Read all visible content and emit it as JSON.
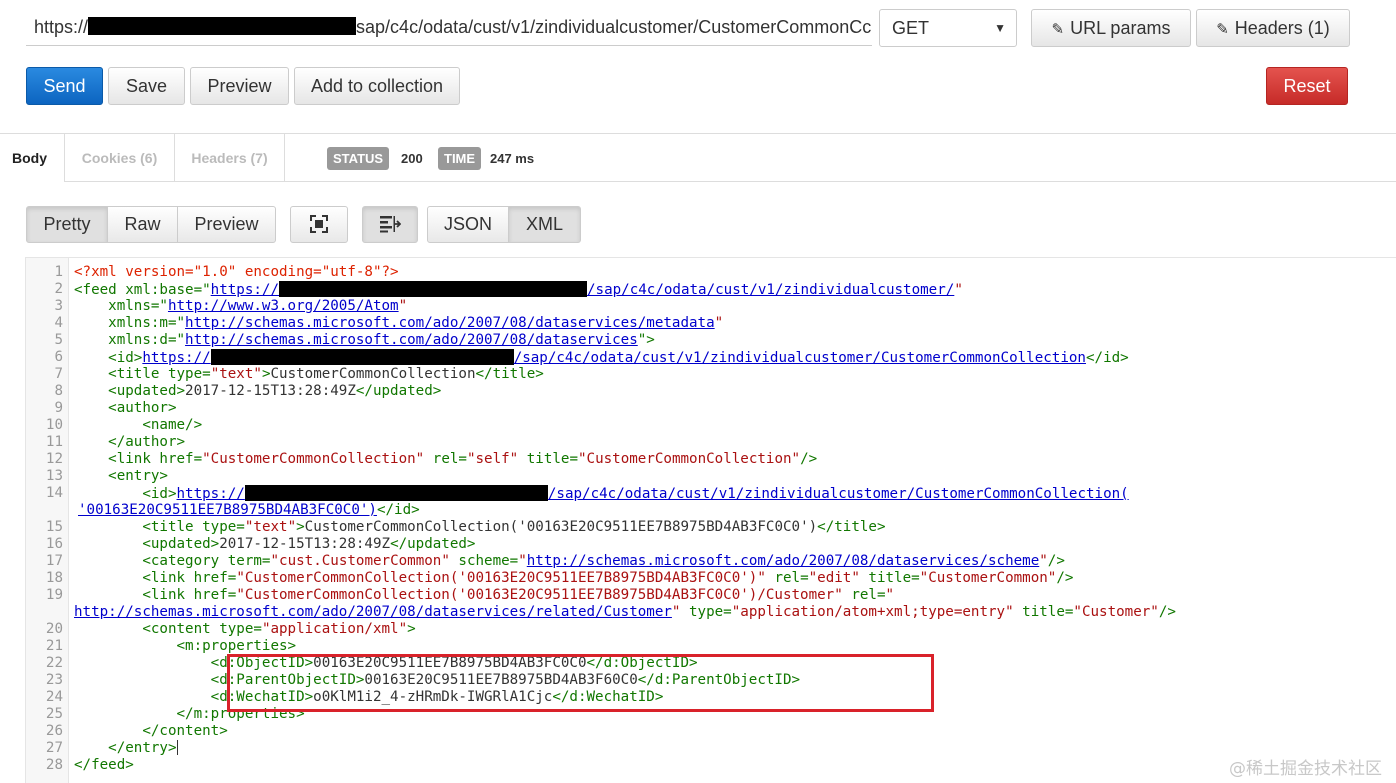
{
  "request": {
    "url_prefix": "https://",
    "url_suffix": "sap/c4c/odata/cust/v1/zindividualcustomer/CustomerCommonCc",
    "method": "GET",
    "url_params_label": "URL params",
    "headers_label": "Headers (1)"
  },
  "actions": {
    "send": "Send",
    "save": "Save",
    "preview": "Preview",
    "add_to_collection": "Add to collection",
    "reset": "Reset"
  },
  "response": {
    "tabs": {
      "body": "Body",
      "cookies": "Cookies (6)",
      "headers": "Headers (7)"
    },
    "status_label": "STATUS",
    "status_value": "200",
    "time_label": "TIME",
    "time_value": "247 ms"
  },
  "view": {
    "pretty": "Pretty",
    "raw": "Raw",
    "preview": "Preview",
    "json": "JSON",
    "xml": "XML"
  },
  "code": {
    "l1": "<?xml version=\"1.0\" encoding=\"utf-8\"?>",
    "l2_a": "<feed xml:base=\"",
    "l2_url_a": "https://",
    "l2_url_b": "/sap/c4c/odata/cust/v1/zindividualcustomer/",
    "l3_a": "xmlns=\"",
    "l3_url": "http://www.w3.org/2005/Atom",
    "l4_a": "xmlns:m=\"",
    "l4_url": "http://schemas.microsoft.com/ado/2007/08/dataservices/metadata",
    "l5_a": "xmlns:d=\"",
    "l5_url": "http://schemas.microsoft.com/ado/2007/08/dataservices",
    "l6_url_a": "https://",
    "l6_url_b": "/sap/c4c/odata/cust/v1/zindividualcustomer/CustomerCommonCollection",
    "l7_text": "CustomerCommonCollection",
    "l8_text": "2017-12-15T13:28:49Z",
    "l12_href": "\"CustomerCommonCollection\"",
    "l12_rel": "\"self\"",
    "l12_title": "\"CustomerCommonCollection\"",
    "l14_url_a": "https://",
    "l14_url_b": "/sap/c4c/odata/cust/v1/zindividualcustomer/CustomerCommonCollection(",
    "l14_cont": "'00163E20C9511EE7B8975BD4AB3FC0C0')",
    "l15_text": "CustomerCommonCollection('00163E20C9511EE7B8975BD4AB3FC0C0')",
    "l16_text": "2017-12-15T13:28:49Z",
    "l17_term": "\"cust.CustomerCommon\"",
    "l17_url": "http://schemas.microsoft.com/ado/2007/08/dataservices/scheme",
    "l18_href": "\"CustomerCommonCollection('00163E20C9511EE7B8975BD4AB3FC0C0')\"",
    "l18_rel": "\"edit\"",
    "l18_title": "\"CustomerCommon\"",
    "l19_href": "\"CustomerCommonCollection('00163E20C9511EE7B8975BD4AB3FC0C0')/Customer\"",
    "l19_cont_url": "http://schemas.microsoft.com/ado/2007/08/dataservices/related/Customer",
    "l19_type": "\"application/atom+xml;type=entry\"",
    "l19_title": "\"Customer\"",
    "l20_type": "\"application/xml\"",
    "object_id": "00163E20C9511EE7B8975BD4AB3FC0C0",
    "parent_object_id": "00163E20C9511EE7B8975BD4AB3F60C0",
    "wechat_id": "o0KlM1i2_4-zHRmDk-IWGRlA1Cjc"
  },
  "watermark": "@稀土掘金技术社区"
}
